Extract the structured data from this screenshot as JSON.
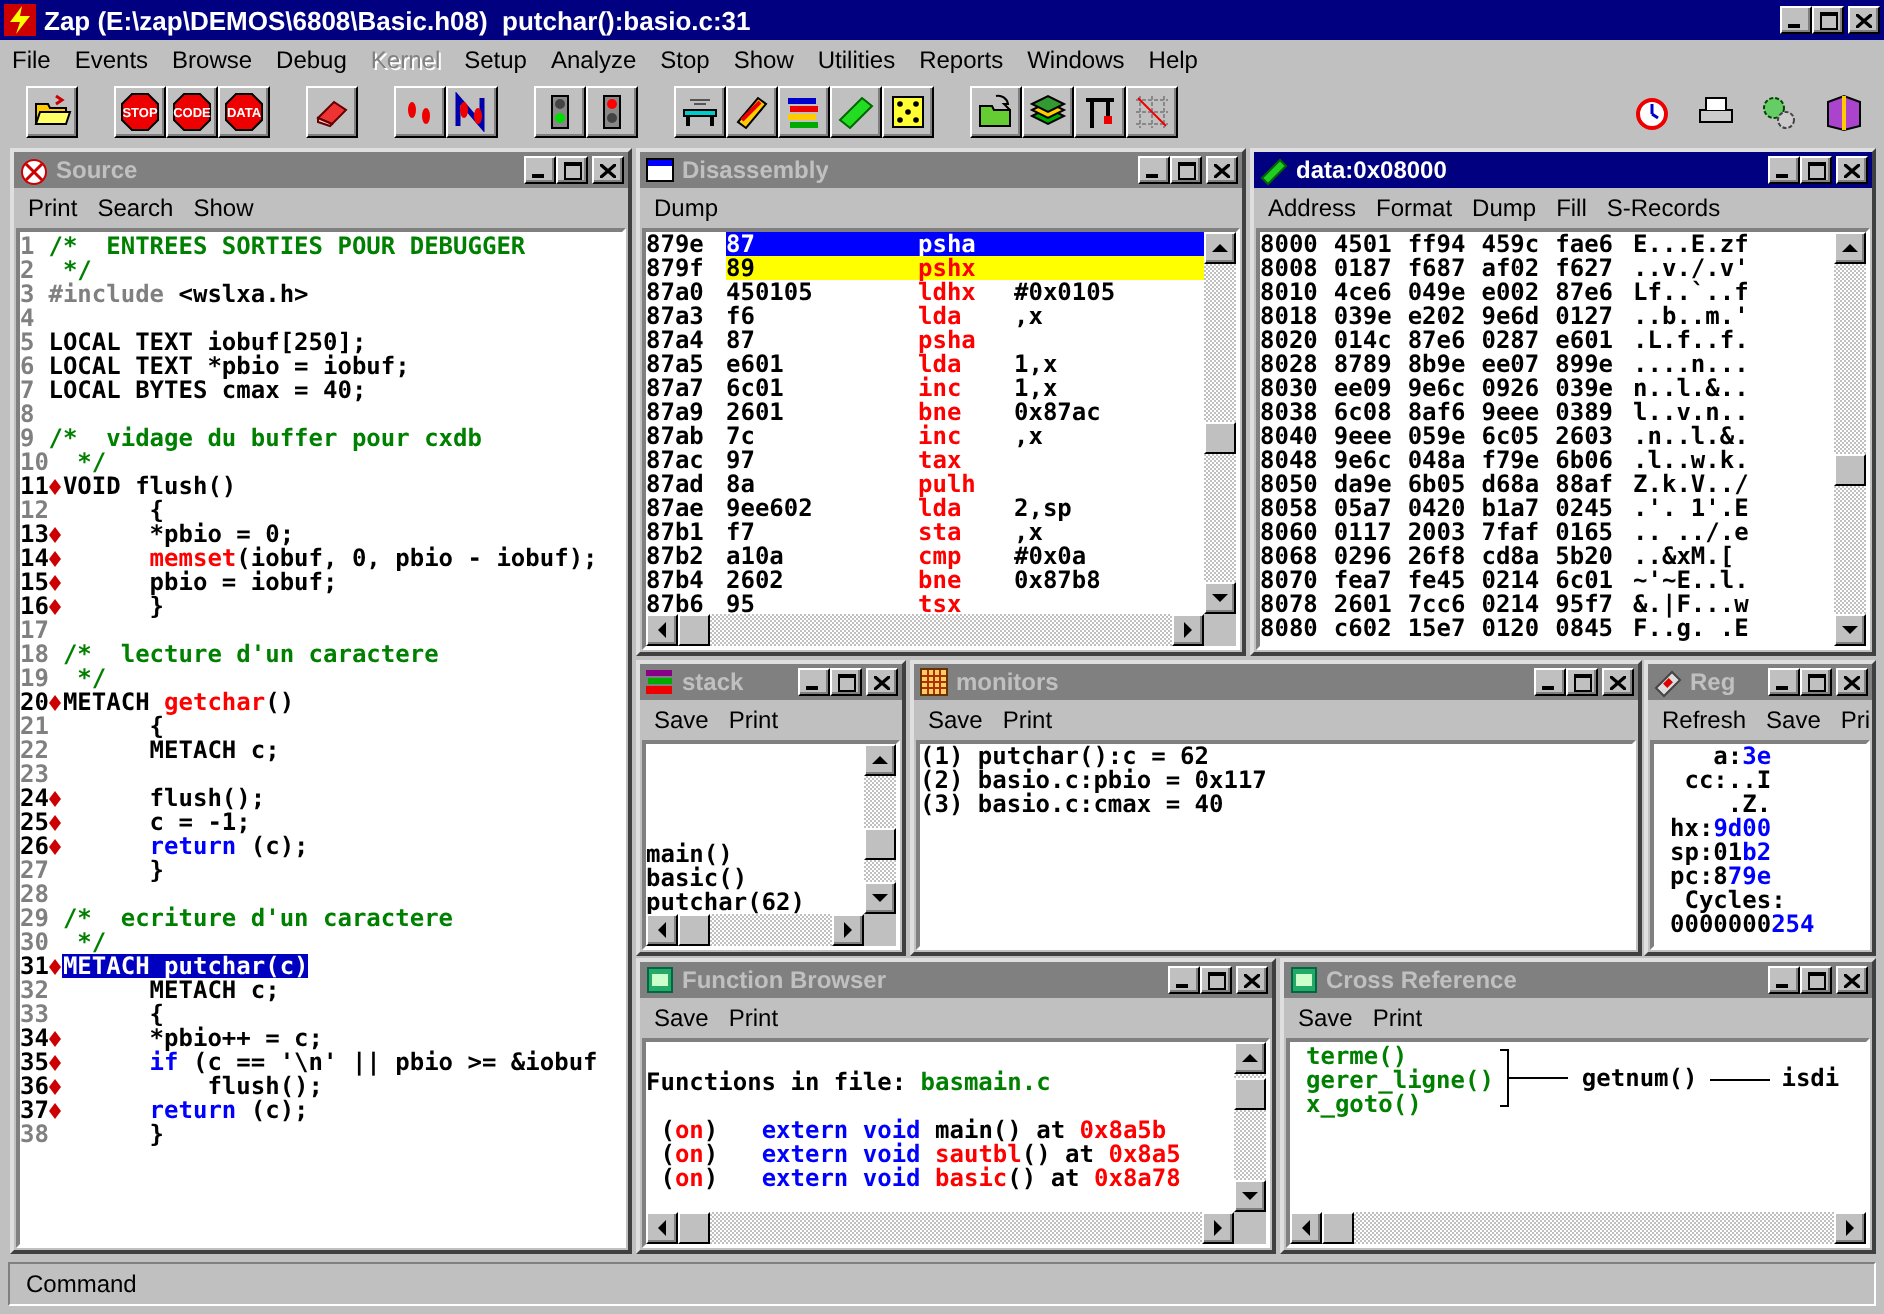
{
  "window": {
    "title": "Zap (E:\\zap\\DEMOS\\6808\\Basic.h08)  putchar():basio.c:31"
  },
  "menu": [
    {
      "label": "File",
      "disabled": false
    },
    {
      "label": "Events",
      "disabled": false
    },
    {
      "label": "Browse",
      "disabled": false
    },
    {
      "label": "Debug",
      "disabled": false
    },
    {
      "label": "Kernel",
      "disabled": true
    },
    {
      "label": "Setup",
      "disabled": false
    },
    {
      "label": "Analyze",
      "disabled": false
    },
    {
      "label": "Stop",
      "disabled": false
    },
    {
      "label": "Show",
      "disabled": false
    },
    {
      "label": "Utilities",
      "disabled": false
    },
    {
      "label": "Reports",
      "disabled": false
    },
    {
      "label": "Windows",
      "disabled": false
    },
    {
      "label": "Help",
      "disabled": false
    }
  ],
  "toolbar": {
    "groups": [
      [
        {
          "kind": "folder"
        }
      ],
      [
        {
          "kind": "stop-sign",
          "label": "STOP"
        },
        {
          "kind": "stop-sign",
          "label": "CODE"
        },
        {
          "kind": "stop-sign",
          "label": "DATA"
        }
      ],
      [
        {
          "kind": "eraser"
        }
      ],
      [
        {
          "kind": "footprints"
        },
        {
          "kind": "footprints-letter"
        }
      ],
      [
        {
          "kind": "go-light"
        },
        {
          "kind": "stop-light"
        }
      ],
      [
        {
          "kind": "bench"
        },
        {
          "kind": "pencil"
        },
        {
          "kind": "bars"
        },
        {
          "kind": "chip"
        },
        {
          "kind": "dice"
        }
      ],
      [
        {
          "kind": "folder-arrow"
        },
        {
          "kind": "books"
        },
        {
          "kind": "crane"
        },
        {
          "kind": "grid"
        }
      ]
    ],
    "right": [
      {
        "kind": "clock"
      },
      {
        "kind": "printer"
      },
      {
        "kind": "gears"
      },
      {
        "kind": "book"
      }
    ]
  },
  "source": {
    "title": "Source",
    "active": false,
    "menu": [
      "Print",
      "Search",
      "Show"
    ],
    "lines": [
      {
        "number": "1",
        "breakpoint": false,
        "selected": false,
        "segments": [
          {
            "kind": "comment",
            "text": "/*  ENTREES SORTIES POUR DEBUGGER"
          }
        ]
      },
      {
        "number": "2",
        "breakpoint": false,
        "selected": false,
        "segments": [
          {
            "kind": "comment",
            "text": " */"
          }
        ]
      },
      {
        "number": "3",
        "breakpoint": false,
        "selected": false,
        "segments": [
          {
            "kind": "preproc",
            "text": "#include"
          },
          {
            "kind": "plain",
            "text": " <wslxa.h>"
          }
        ]
      },
      {
        "number": "4",
        "breakpoint": false,
        "selected": false
      },
      {
        "number": "5",
        "breakpoint": false,
        "selected": false,
        "segments": [
          {
            "kind": "plain",
            "text": "LOCAL TEXT iobuf[250];"
          }
        ]
      },
      {
        "number": "6",
        "breakpoint": false,
        "selected": false,
        "segments": [
          {
            "kind": "plain",
            "text": "LOCAL TEXT *pbio = iobuf;"
          }
        ]
      },
      {
        "number": "7",
        "breakpoint": false,
        "selected": false,
        "segments": [
          {
            "kind": "plain",
            "text": "LOCAL BYTES cmax = 40;"
          }
        ]
      },
      {
        "number": "8",
        "breakpoint": false,
        "selected": false
      },
      {
        "number": "9",
        "breakpoint": false,
        "selected": false,
        "segments": [
          {
            "kind": "comment",
            "text": "/*  vidage du buffer pour cxdb"
          }
        ]
      },
      {
        "number": "10",
        "breakpoint": false,
        "selected": false,
        "segments": [
          {
            "kind": "comment",
            "text": " */"
          }
        ]
      },
      {
        "number": "11",
        "breakpoint": true,
        "selected": false,
        "segments": [
          {
            "kind": "plain",
            "text": "VOID flush()"
          }
        ]
      },
      {
        "number": "12",
        "breakpoint": false,
        "selected": false,
        "segments": [
          {
            "kind": "plain",
            "text": "      {"
          }
        ]
      },
      {
        "number": "13",
        "breakpoint": true,
        "selected": false,
        "segments": [
          {
            "kind": "plain",
            "text": "      *pbio = 0;"
          }
        ]
      },
      {
        "number": "14",
        "breakpoint": true,
        "selected": false,
        "segments": [
          {
            "kind": "call",
            "text": "      memset"
          },
          {
            "kind": "plain",
            "text": "(iobuf, 0, pbio - iobuf);"
          }
        ]
      },
      {
        "number": "15",
        "breakpoint": true,
        "selected": false,
        "segments": [
          {
            "kind": "plain",
            "text": "      pbio = iobuf;"
          }
        ]
      },
      {
        "number": "16",
        "breakpoint": true,
        "selected": false,
        "segments": [
          {
            "kind": "plain",
            "text": "      }"
          }
        ]
      },
      {
        "number": "17",
        "breakpoint": false,
        "selected": false
      },
      {
        "number": "18",
        "breakpoint": false,
        "selected": false,
        "segments": [
          {
            "kind": "comment",
            "text": "/*  lecture d'un caractere"
          }
        ]
      },
      {
        "number": "19",
        "breakpoint": false,
        "selected": false,
        "segments": [
          {
            "kind": "comment",
            "text": " */"
          }
        ]
      },
      {
        "number": "20",
        "breakpoint": true,
        "selected": false,
        "segments": [
          {
            "kind": "plain",
            "text": "METACH "
          },
          {
            "kind": "call",
            "text": "getchar"
          },
          {
            "kind": "plain",
            "text": "()"
          }
        ]
      },
      {
        "number": "21",
        "breakpoint": false,
        "selected": false,
        "segments": [
          {
            "kind": "plain",
            "text": "      {"
          }
        ]
      },
      {
        "number": "22",
        "breakpoint": false,
        "selected": false,
        "segments": [
          {
            "kind": "plain",
            "text": "      METACH c;"
          }
        ]
      },
      {
        "number": "23",
        "breakpoint": false,
        "selected": false
      },
      {
        "number": "24",
        "breakpoint": true,
        "selected": false,
        "segments": [
          {
            "kind": "plain",
            "text": "      flush();"
          }
        ]
      },
      {
        "number": "25",
        "breakpoint": true,
        "selected": false,
        "segments": [
          {
            "kind": "plain",
            "text": "      c = -1;"
          }
        ]
      },
      {
        "number": "26",
        "breakpoint": true,
        "selected": false,
        "segments": [
          {
            "kind": "keyword",
            "text": "      return"
          },
          {
            "kind": "plain",
            "text": " (c);"
          }
        ]
      },
      {
        "number": "27",
        "breakpoint": false,
        "selected": false,
        "segments": [
          {
            "kind": "plain",
            "text": "      }"
          }
        ]
      },
      {
        "number": "28",
        "breakpoint": false,
        "selected": false
      },
      {
        "number": "29",
        "breakpoint": false,
        "selected": false,
        "segments": [
          {
            "kind": "comment",
            "text": "/*  ecriture d'un caractere"
          }
        ]
      },
      {
        "number": "30",
        "breakpoint": false,
        "selected": false,
        "segments": [
          {
            "kind": "comment",
            "text": " */"
          }
        ]
      },
      {
        "number": "31",
        "breakpoint": true,
        "selected": true,
        "segments": [
          {
            "kind": "plain",
            "text": "METACH putchar(c)"
          }
        ]
      },
      {
        "number": "32",
        "breakpoint": false,
        "selected": false,
        "segments": [
          {
            "kind": "plain",
            "text": "      METACH c;"
          }
        ]
      },
      {
        "number": "33",
        "breakpoint": false,
        "selected": false,
        "segments": [
          {
            "kind": "plain",
            "text": "      {"
          }
        ]
      },
      {
        "number": "34",
        "breakpoint": true,
        "selected": false,
        "segments": [
          {
            "kind": "plain",
            "text": "      *pbio++ = c;"
          }
        ]
      },
      {
        "number": "35",
        "breakpoint": true,
        "selected": false,
        "segments": [
          {
            "kind": "keyword",
            "text": "      if"
          },
          {
            "kind": "plain",
            "text": " (c == '\\n' || pbio >= &iobuf"
          }
        ]
      },
      {
        "number": "36",
        "breakpoint": true,
        "selected": false,
        "segments": [
          {
            "kind": "plain",
            "text": "          flush();"
          }
        ]
      },
      {
        "number": "37",
        "breakpoint": true,
        "selected": false,
        "segments": [
          {
            "kind": "keyword",
            "text": "      return"
          },
          {
            "kind": "plain",
            "text": " (c);"
          }
        ]
      },
      {
        "number": "38",
        "breakpoint": false,
        "selected": false,
        "segments": [
          {
            "kind": "plain",
            "text": "      }"
          }
        ]
      }
    ]
  },
  "disassembly": {
    "title": "Disassembly",
    "active": false,
    "menu": [
      "Dump"
    ],
    "rows": [
      {
        "address": "879e",
        "bytes": "87",
        "mnemonic": "psha",
        "selected": true,
        "highlighted": false
      },
      {
        "address": "879f",
        "bytes": "89",
        "mnemonic": "pshx",
        "selected": false,
        "highlighted": true
      },
      {
        "address": "87a0",
        "bytes": "450105",
        "mnemonic": "ldhx",
        "operand": "#0x0105",
        "selected": false,
        "highlighted": false
      },
      {
        "address": "87a3",
        "bytes": "f6",
        "mnemonic": "lda",
        "operand": ",x",
        "selected": false,
        "highlighted": false
      },
      {
        "address": "87a4",
        "bytes": "87",
        "mnemonic": "psha",
        "selected": false,
        "highlighted": false
      },
      {
        "address": "87a5",
        "bytes": "e601",
        "mnemonic": "lda",
        "operand": "1,x",
        "selected": false,
        "highlighted": false
      },
      {
        "address": "87a7",
        "bytes": "6c01",
        "mnemonic": "inc",
        "operand": "1,x",
        "selected": false,
        "highlighted": false
      },
      {
        "address": "87a9",
        "bytes": "2601",
        "mnemonic": "bne",
        "operand": "0x87ac",
        "selected": false,
        "highlighted": false
      },
      {
        "address": "87ab",
        "bytes": "7c",
        "mnemonic": "inc",
        "operand": ",x",
        "selected": false,
        "highlighted": false
      },
      {
        "address": "87ac",
        "bytes": "97",
        "mnemonic": "tax",
        "selected": false,
        "highlighted": false
      },
      {
        "address": "87ad",
        "bytes": "8a",
        "mnemonic": "pulh",
        "selected": false,
        "highlighted": false
      },
      {
        "address": "87ae",
        "bytes": "9ee602",
        "mnemonic": "lda",
        "operand": "2,sp",
        "selected": false,
        "highlighted": false
      },
      {
        "address": "87b1",
        "bytes": "f7",
        "mnemonic": "sta",
        "operand": ",x",
        "selected": false,
        "highlighted": false
      },
      {
        "address": "87b2",
        "bytes": "a10a",
        "mnemonic": "cmp",
        "operand": "#0x0a",
        "selected": false,
        "highlighted": false
      },
      {
        "address": "87b4",
        "bytes": "2602",
        "mnemonic": "bne",
        "operand": "0x87b8",
        "selected": false,
        "highlighted": false
      },
      {
        "address": "87b6",
        "bytes": "95",
        "mnemonic": "tsx",
        "selected": false,
        "highlighted": false
      }
    ]
  },
  "data": {
    "title": "data:0x08000",
    "active": true,
    "menu": [
      "Address",
      "Format",
      "Dump",
      "Fill",
      "S-Records"
    ],
    "rows": [
      {
        "address": "8000",
        "words": [
          "4501",
          "ff94",
          "459c",
          "fae6"
        ],
        "ascii": "E...E.zf"
      },
      {
        "address": "8008",
        "words": [
          "0187",
          "f687",
          "af02",
          "f627"
        ],
        "ascii": "..v./.v'"
      },
      {
        "address": "8010",
        "words": [
          "4ce6",
          "049e",
          "e002",
          "87e6"
        ],
        "ascii": "Lf..`..f"
      },
      {
        "address": "8018",
        "words": [
          "039e",
          "e202",
          "9e6d",
          "0127"
        ],
        "ascii": "..b..m.'"
      },
      {
        "address": "8020",
        "words": [
          "014c",
          "87e6",
          "0287",
          "e601"
        ],
        "ascii": ".L.f..f."
      },
      {
        "address": "8028",
        "words": [
          "8789",
          "8b9e",
          "ee07",
          "899e"
        ],
        "ascii": "....n..."
      },
      {
        "address": "8030",
        "words": [
          "ee09",
          "9e6c",
          "0926",
          "039e"
        ],
        "ascii": "n..l.&.."
      },
      {
        "address": "8038",
        "words": [
          "6c08",
          "8af6",
          "9eee",
          "0389"
        ],
        "ascii": "l..v.n.."
      },
      {
        "address": "8040",
        "words": [
          "9eee",
          "059e",
          "6c05",
          "2603"
        ],
        "ascii": ".n..l.&."
      },
      {
        "address": "8048",
        "words": [
          "9e6c",
          "048a",
          "f79e",
          "6b06"
        ],
        "ascii": ".l..w.k."
      },
      {
        "address": "8050",
        "words": [
          "da9e",
          "6b05",
          "d68a",
          "88af"
        ],
        "ascii": "Z.k.V../"
      },
      {
        "address": "8058",
        "words": [
          "05a7",
          "0420",
          "b1a7",
          "0245"
        ],
        "ascii": ".'. 1'.E"
      },
      {
        "address": "8060",
        "words": [
          "0117",
          "2003",
          "7faf",
          "0165"
        ],
        "ascii": ".. ../.e"
      },
      {
        "address": "8068",
        "words": [
          "0296",
          "26f8",
          "cd8a",
          "5b20"
        ],
        "ascii": "..&xM.["
      },
      {
        "address": "8070",
        "words": [
          "fea7",
          "fe45",
          "0214",
          "6c01"
        ],
        "ascii": "~'~E..l."
      },
      {
        "address": "8078",
        "words": [
          "2601",
          "7cc6",
          "0214",
          "95f7"
        ],
        "ascii": "&.|F...w"
      },
      {
        "address": "8080",
        "words": [
          "c602",
          "15e7",
          "0120",
          "0845"
        ],
        "ascii": "F..g. .E"
      }
    ]
  },
  "stack": {
    "title": "stack",
    "active": false,
    "menu": [
      "Save",
      "Print"
    ],
    "frames": [
      "main()",
      "basic()",
      "putchar(62)"
    ]
  },
  "monitors": {
    "title": "monitors",
    "active": false,
    "menu": [
      "Save",
      "Print"
    ],
    "items": [
      "(1) putchar():c = 62",
      "(2) basio.c:pbio = 0x117",
      "(3) basio.c:cmax = 40"
    ]
  },
  "registers": {
    "title": "Reg",
    "active": false,
    "menu": [
      "Refresh",
      "Save",
      "Pri"
    ],
    "lines": [
      [
        {
          "kind": "plain",
          "text": "   a:"
        },
        {
          "kind": "changed",
          "text": "3e"
        }
      ],
      [
        {
          "kind": "plain",
          "text": " cc:..I"
        }
      ],
      [
        {
          "kind": "plain",
          "text": "    .Z."
        }
      ],
      [
        {
          "kind": "plain",
          "text": "hx:"
        },
        {
          "kind": "changed",
          "text": "9d00"
        }
      ],
      [
        {
          "kind": "plain",
          "text": "sp:01"
        },
        {
          "kind": "changed",
          "text": "b2"
        }
      ],
      [
        {
          "kind": "plain",
          "text": "pc:8"
        },
        {
          "kind": "changed",
          "text": "79e"
        }
      ],
      [
        {
          "kind": "plain",
          "text": " Cycles:"
        }
      ],
      [
        {
          "kind": "plain",
          "text": "0000000"
        },
        {
          "kind": "changed",
          "text": "254"
        }
      ]
    ]
  },
  "function_browser": {
    "title": "Function Browser",
    "active": false,
    "menu": [
      "Save",
      "Print"
    ],
    "heading": [
      {
        "kind": "plain",
        "text": "Functions in file: "
      },
      {
        "kind": "symbol",
        "text": "basmain.c"
      }
    ],
    "functions": [
      [
        {
          "kind": "plain",
          "text": " ("
        },
        {
          "kind": "call",
          "text": "on"
        },
        {
          "kind": "plain",
          "text": ")   "
        },
        {
          "kind": "keyword",
          "text": "extern void"
        },
        {
          "kind": "plain",
          "text": " main() at "
        },
        {
          "kind": "call",
          "text": "0x8a5b"
        }
      ],
      [
        {
          "kind": "plain",
          "text": " ("
        },
        {
          "kind": "call",
          "text": "on"
        },
        {
          "kind": "plain",
          "text": ")   "
        },
        {
          "kind": "keyword",
          "text": "extern void "
        },
        {
          "kind": "call",
          "text": "sautbl"
        },
        {
          "kind": "plain",
          "text": "() at "
        },
        {
          "kind": "call",
          "text": "0x8a5"
        }
      ],
      [
        {
          "kind": "plain",
          "text": " ("
        },
        {
          "kind": "call",
          "text": "on"
        },
        {
          "kind": "plain",
          "text": ")   "
        },
        {
          "kind": "keyword",
          "text": "extern void "
        },
        {
          "kind": "call",
          "text": "basic"
        },
        {
          "kind": "plain",
          "text": "() at "
        },
        {
          "kind": "call",
          "text": "0x8a78"
        }
      ]
    ]
  },
  "cross_reference": {
    "title": "Cross Reference",
    "active": false,
    "menu": [
      "Save",
      "Print"
    ],
    "callers": [
      "terme()",
      "gerer_ligne()",
      "x_goto()"
    ],
    "callees": [
      "getnum()",
      "isdi"
    ]
  },
  "status_bar": {
    "label": "Command"
  }
}
